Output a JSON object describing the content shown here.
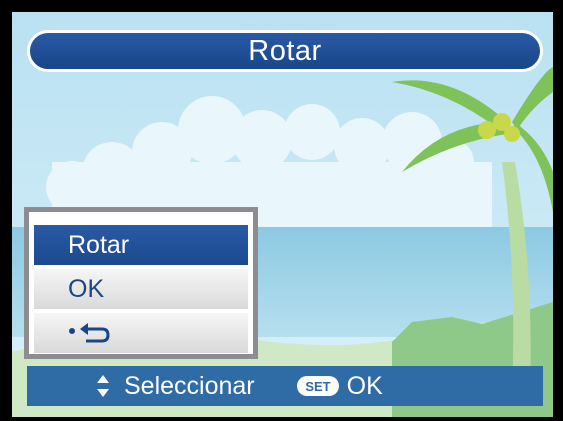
{
  "title": "Rotar",
  "menu": {
    "items": [
      {
        "label": "Rotar",
        "selected": true
      },
      {
        "label": "OK",
        "selected": false
      },
      {
        "label": "",
        "icon": "return-back-icon",
        "selected": false
      }
    ]
  },
  "bottom_bar": {
    "select_label": "Seleccionar",
    "select_icon": "up-down-arrows-icon",
    "set_badge": "SET",
    "ok_label": "OK"
  },
  "colors": {
    "title_bar": "#1e4f96",
    "selected_item": "#1e4f96",
    "bottom_bar": "#2f6ca6",
    "menu_border": "#8b8d91"
  }
}
